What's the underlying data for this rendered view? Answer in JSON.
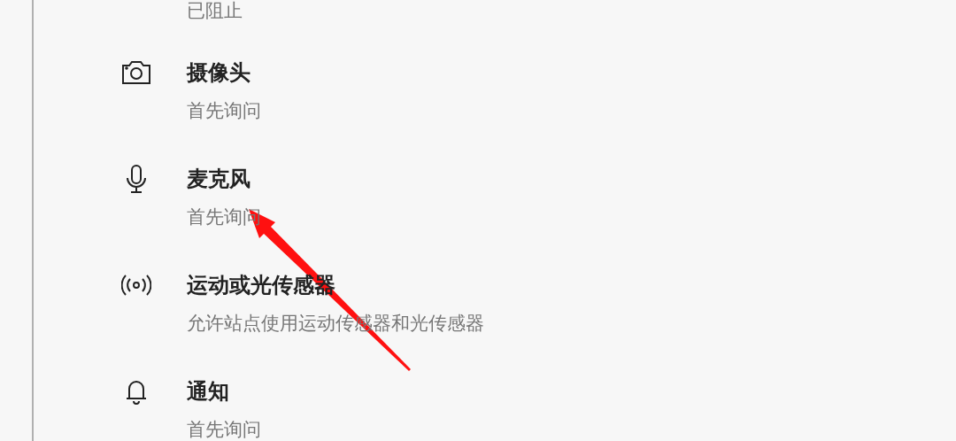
{
  "permissions": [
    {
      "kind": "none",
      "subtitle": "已阻止"
    },
    {
      "kind": "camera",
      "title": "摄像头",
      "subtitle": "首先询问"
    },
    {
      "kind": "microphone",
      "title": "麦克风",
      "subtitle": "首先询问"
    },
    {
      "kind": "sensor",
      "title": "运动或光传感器",
      "subtitle": "允许站点使用运动传感器和光传感器"
    },
    {
      "kind": "bell",
      "title": "通知",
      "subtitle": "首先询问"
    }
  ]
}
